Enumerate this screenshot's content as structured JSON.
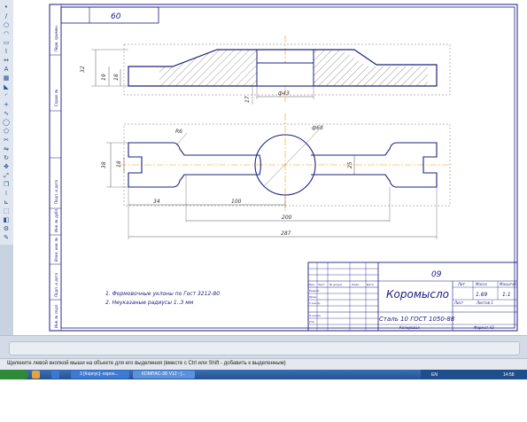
{
  "drawing": {
    "corner_number": "60",
    "side_stamps": [
      "Перв. примен.",
      "Справ. №",
      "Подп. и дата",
      "Инв. № дубл.",
      "Взам. инв. №",
      "Подп. и дата",
      "Инв. № подл."
    ],
    "top_view": {
      "dim_32": "32",
      "dim_19": "19",
      "dim_18": "18",
      "dim_17": "17",
      "dim_d43": "ф43"
    },
    "front_view": {
      "radius_r6": "R6",
      "dia_68": "ф68",
      "dim_38": "38",
      "dim_18": "18",
      "dim_25": "25",
      "dim_34": "34",
      "dim_100": "100",
      "dim_200": "200",
      "dim_287": "287"
    },
    "notes": [
      "1. Формовочные уклоны по Гост 3212-80",
      "2. Неуказаные радиусы 1..3 мм"
    ],
    "title_block": {
      "doc_code": "09",
      "part_name": "Коромысло",
      "material": "Сталь 10  ГОСТ 1050-88",
      "header_lit": "Лит.",
      "header_mass": "Масса",
      "header_scale": "Масштаб",
      "mass": "1.69",
      "scale": "1:1",
      "sheet": "Лист",
      "sheets": "Листов  1",
      "row_labels": [
        "Изм.",
        "Лист",
        "№ докум.",
        "Подп.",
        "Дата"
      ],
      "role_labels": [
        "Разраб.",
        "Пров.",
        "Т.контр.",
        "Н.контр.",
        "Утв."
      ],
      "copied": "Копировал",
      "format": "Формат  А3"
    }
  },
  "status": {
    "message": "Щелкните левой кнопкой мыши на объекте для его выделения (вместе с Ctrl или Shift - добавить к выделенным)"
  },
  "taskbar": {
    "buttons": [
      "3 [Корпус]- корон...",
      "КОМПАС-3D V12 - [..."
    ],
    "lang": "EN",
    "clock": "14:58"
  },
  "colors": {
    "part_outline": "#1a237e",
    "axis_line": "#ff9800",
    "sheet_line": "#1a1a80",
    "taskbar": "#24528f",
    "start": "#2d8a37"
  }
}
